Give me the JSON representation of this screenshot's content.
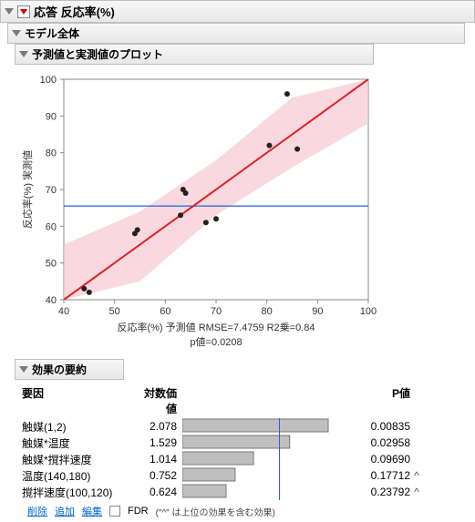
{
  "header": {
    "title": "応答 反応率(%)"
  },
  "model_section": {
    "title": "モデル全体"
  },
  "plot_section": {
    "title": "予測値と実測値のプロット",
    "y_label": "反応率(%) 実測値",
    "x_label": "反応率(%) 予測値 RMSE=7.4759  R2乗=0.84",
    "p_label": "p値=0.0208"
  },
  "chart_data": {
    "type": "scatter",
    "title": "予測値と実測値のプロット",
    "xlabel": "反応率(%) 予測値",
    "ylabel": "反応率(%) 実測値",
    "xlim": [
      40,
      100
    ],
    "ylim": [
      40,
      100
    ],
    "points": [
      {
        "x": 44,
        "y": 43
      },
      {
        "x": 45,
        "y": 42
      },
      {
        "x": 54,
        "y": 58
      },
      {
        "x": 54.5,
        "y": 59
      },
      {
        "x": 63,
        "y": 63
      },
      {
        "x": 63.5,
        "y": 70
      },
      {
        "x": 64,
        "y": 69
      },
      {
        "x": 68,
        "y": 61
      },
      {
        "x": 70,
        "y": 62
      },
      {
        "x": 80.5,
        "y": 82
      },
      {
        "x": 84,
        "y": 96
      },
      {
        "x": 86,
        "y": 81
      }
    ],
    "fit_line": {
      "slope": 1,
      "intercept": 0
    },
    "reference_y": 65.5,
    "confidence_band": [
      {
        "x": 40,
        "lo": 24,
        "hi": 55
      },
      {
        "x": 55,
        "lo": 45,
        "hi": 64
      },
      {
        "x": 70,
        "lo": 63,
        "hi": 78
      },
      {
        "x": 85,
        "lo": 76,
        "hi": 95
      },
      {
        "x": 100,
        "lo": 88,
        "hi": 116
      }
    ]
  },
  "effect_section": {
    "title": "効果の要約",
    "col_factor": "要因",
    "col_log": "対数価値",
    "col_p": "P値",
    "rows": [
      {
        "factor": "触媒(1,2)",
        "log": "2.078",
        "bar": 2.078,
        "p": "0.00835",
        "hat": ""
      },
      {
        "factor": "触媒*温度",
        "log": "1.529",
        "bar": 1.529,
        "p": "0.02958",
        "hat": ""
      },
      {
        "factor": "触媒*撹拌速度",
        "log": "1.014",
        "bar": 1.014,
        "p": "0.09690",
        "hat": ""
      },
      {
        "factor": "温度(140,180)",
        "log": "0.752",
        "bar": 0.752,
        "p": "0.17712",
        "hat": "^"
      },
      {
        "factor": "撹拌速度(100,120)",
        "log": "0.624",
        "bar": 0.624,
        "p": "0.23792",
        "hat": "^"
      }
    ],
    "bar_ref": 1.3
  },
  "footer": {
    "remove": "削除",
    "add": "追加",
    "edit": "編集",
    "fdr": "FDR",
    "note": "(\"^\" は上位の効果を含む効果)"
  }
}
